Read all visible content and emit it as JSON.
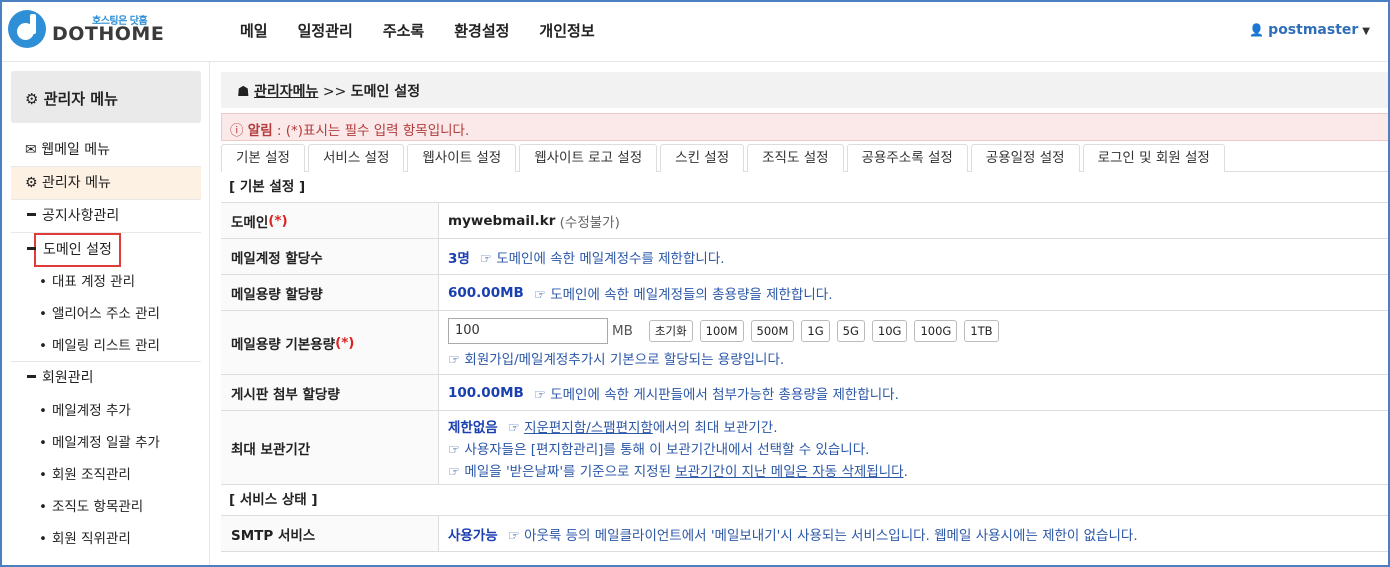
{
  "header": {
    "logo_sub": "호스팅은 닷홈",
    "logo_text": "DOTHOME",
    "nav": [
      "메일",
      "일정관리",
      "주소록",
      "환경설정",
      "개인정보"
    ],
    "user": "postmaster"
  },
  "sidebar": {
    "title": "관리자 메뉴",
    "items": {
      "webmail": "웹메일 메뉴",
      "admin": "관리자 메뉴",
      "notice": "공지사항관리",
      "domain": "도메인 설정",
      "rep_account": "대표 계정 관리",
      "alias": "앨리어스 주소 관리",
      "mailing": "메일링 리스트 관리",
      "member": "회원관리",
      "add_account": "메일계정 추가",
      "bulk_add": "메일계정 일괄 추가",
      "org": "회원 조직관리",
      "org_item": "조직도 항목관리",
      "position": "회원 직위관리"
    }
  },
  "breadcrumb": {
    "parent": "관리자메뉴",
    "sep": ">>",
    "current": "도메인 설정"
  },
  "alert": {
    "label": "알림",
    "text": " : (*)표시는 필수 입력 항목입니다."
  },
  "tabs": [
    "기본 설정",
    "서비스 설정",
    "웹사이트 설정",
    "웹사이트 로고 설정",
    "스킨 설정",
    "조직도 설정",
    "공용주소록 설정",
    "공용일정 설정",
    "로그인 및 회원 설정"
  ],
  "section_basic": "[ 기본 설정 ]",
  "section_service": "[ 서비스 상태 ]",
  "rows": {
    "domain": {
      "label": "도메인",
      "req": "(*)",
      "value": "mywebmail.kr",
      "note": "(수정불가)"
    },
    "quota_count": {
      "label": "메일계정 할당수",
      "value": "3명",
      "hint": "☞ 도메인에 속한 메일계정수를 제한합니다."
    },
    "quota_size": {
      "label": "메일용량 할당량",
      "value": "600.00MB",
      "hint": "☞ 도메인에 속한 메일계정들의 총용량을 제한합니다."
    },
    "default_size": {
      "label": "메일용량 기본용량",
      "req": "(*)",
      "input_value": "100",
      "unit": "MB",
      "buttons": [
        "초기화",
        "100M",
        "500M",
        "1G",
        "5G",
        "10G",
        "100G",
        "1TB"
      ],
      "hint": "☞ 회원가입/메일계정추가시 기본으로 할당되는 용량입니다."
    },
    "board": {
      "label": "게시판 첨부 할당량",
      "value": "100.00MB",
      "hint": "☞ 도메인에 속한 게시판들에서 첨부가능한 총용량을 제한합니다."
    },
    "retention": {
      "label": "최대 보관기간",
      "value": "제한없음",
      "hint1_pre": "☞ ",
      "hint1_link": "지운편지함/스팸편지함",
      "hint1_post": "에서의 최대 보관기간.",
      "hint2": "☞ 사용자들은 [편지함관리]를 통해 이 보관기간내에서 선택할 수 있습니다.",
      "hint3_pre": "☞ 메일을 '받은날짜'를 기준으로 지정된 ",
      "hint3_link": "보관기간이 지난 메일은 자동 삭제됩니다",
      "hint3_post": "."
    },
    "smtp": {
      "label": "SMTP 서비스",
      "value": "사용가능",
      "hint": "☞ 아웃룩 등의 메일클라이언트에서 '메일보내기'시 사용되는 서비스입니다. 웹메일 사용시에는 제한이 없습니다."
    }
  }
}
